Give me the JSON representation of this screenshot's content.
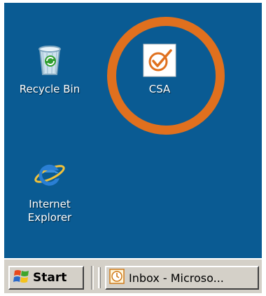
{
  "desktop": {
    "background": "#0a5b93",
    "icons": [
      {
        "label": "Recycle Bin",
        "icon": "recycle-bin-icon"
      },
      {
        "label": "CSA",
        "icon": "csa-checkmark-icon"
      },
      {
        "label": "Internet\nExplorer",
        "icon": "internet-explorer-icon"
      }
    ],
    "highlight_color": "#e0701e"
  },
  "taskbar": {
    "start_label": "Start",
    "tasks": [
      {
        "label": "Inbox - Microso...",
        "icon": "clock-icon"
      }
    ]
  }
}
